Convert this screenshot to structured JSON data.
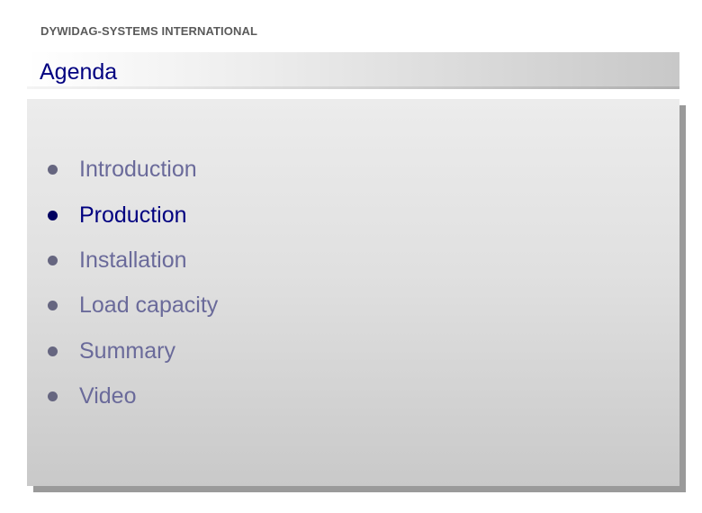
{
  "header": {
    "company": "DYWIDAG-SYSTEMS INTERNATIONAL",
    "title": "Agenda"
  },
  "agenda": {
    "items": [
      {
        "label": "Introduction",
        "active": false
      },
      {
        "label": "Production",
        "active": true
      },
      {
        "label": "Installation",
        "active": false
      },
      {
        "label": "Load capacity",
        "active": false
      },
      {
        "label": "Summary",
        "active": false
      },
      {
        "label": "Video",
        "active": false
      }
    ]
  },
  "colors": {
    "title": "#000080",
    "active_item": "#000080",
    "inactive_item": "#6a6a9a",
    "company": "#5a5a5a"
  }
}
